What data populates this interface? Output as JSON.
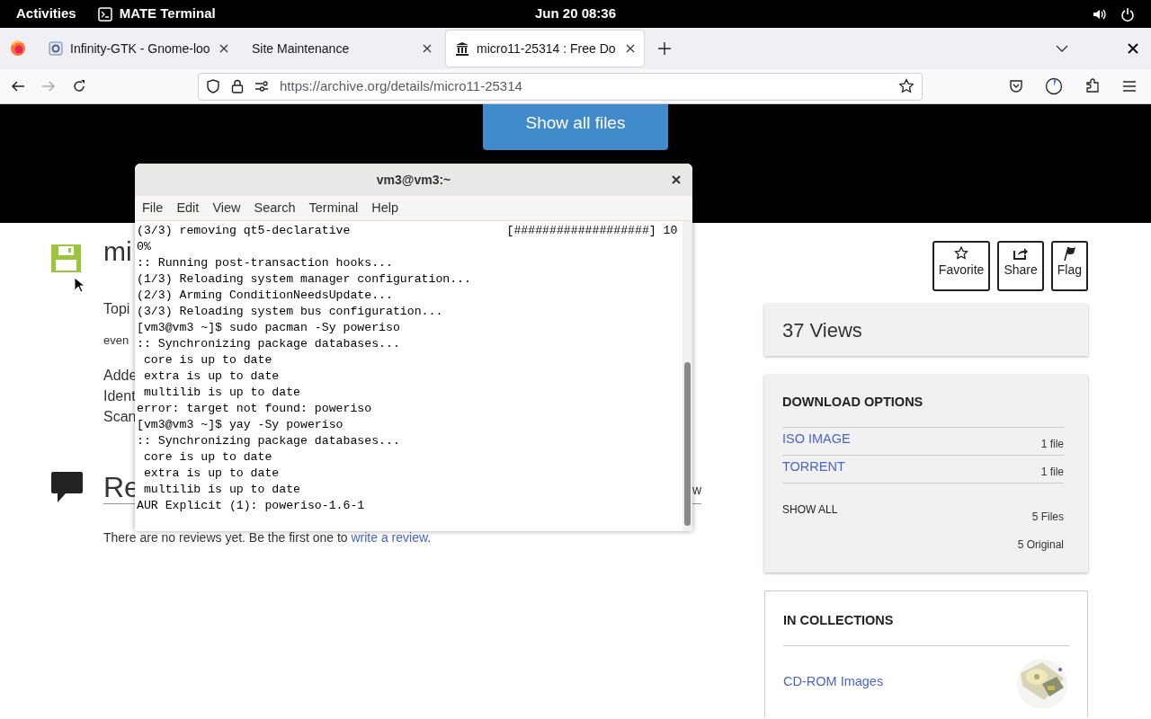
{
  "top_bar": {
    "activities": "Activities",
    "app": "MATE Terminal",
    "clock": "Jun 20  08:36"
  },
  "browser": {
    "tabs": [
      {
        "title": "Infinity-GTK - Gnome-loo",
        "selected": false
      },
      {
        "title": "Site Maintenance",
        "selected": false
      },
      {
        "title": "micro11-25314 : Free Do",
        "selected": true
      }
    ],
    "url": "https://archive.org/details/micro11-25314"
  },
  "page": {
    "show_all_files": "Show all files",
    "title_fragment": "mi",
    "details": [
      "Topi",
      "even",
      "Adde",
      "Ident",
      "Scan"
    ],
    "reviews_heading_fragment": "Re",
    "reviews_right_fragment": "w",
    "reviews_text": "There are no reviews yet. Be the first one to ",
    "reviews_link": "write a review",
    "reviews_end": "."
  },
  "terminal": {
    "title": "vm3@vm3:~",
    "menu": [
      "File",
      "Edit",
      "View",
      "Search",
      "Terminal",
      "Help"
    ],
    "lines": [
      "(3/3) removing qt5-declarative                      [###################] 10",
      "0%",
      ":: Running post-transaction hooks...",
      "(1/3) Reloading system manager configuration...",
      "(2/3) Arming ConditionNeedsUpdate...",
      "(3/3) Reloading system bus configuration...",
      "[vm3@vm3 ~]$ sudo pacman -Sy poweriso",
      ":: Synchronizing package databases...",
      " core is up to date",
      " extra is up to date",
      " multilib is up to date",
      "error: target not found: poweriso",
      "[vm3@vm3 ~]$ yay -Sy poweriso",
      ":: Synchronizing package databases...",
      " core is up to date",
      " extra is up to date",
      " multilib is up to date",
      "AUR Explicit (1): poweriso-1.6-1"
    ]
  },
  "sidebar": {
    "actions": [
      {
        "label": "Favorite"
      },
      {
        "label": "Share"
      },
      {
        "label": "Flag"
      }
    ],
    "views": "37 Views",
    "download_options": {
      "heading": "DOWNLOAD OPTIONS",
      "items": [
        {
          "label": "ISO IMAGE",
          "count": "1 file"
        },
        {
          "label": "TORRENT",
          "count": "1 file"
        }
      ],
      "show_all": "SHOW ALL",
      "files": "5 Files",
      "original": "5 Original"
    },
    "collections": {
      "heading": "IN COLLECTIONS",
      "items": [
        {
          "label": "CD-ROM Images"
        }
      ]
    }
  }
}
